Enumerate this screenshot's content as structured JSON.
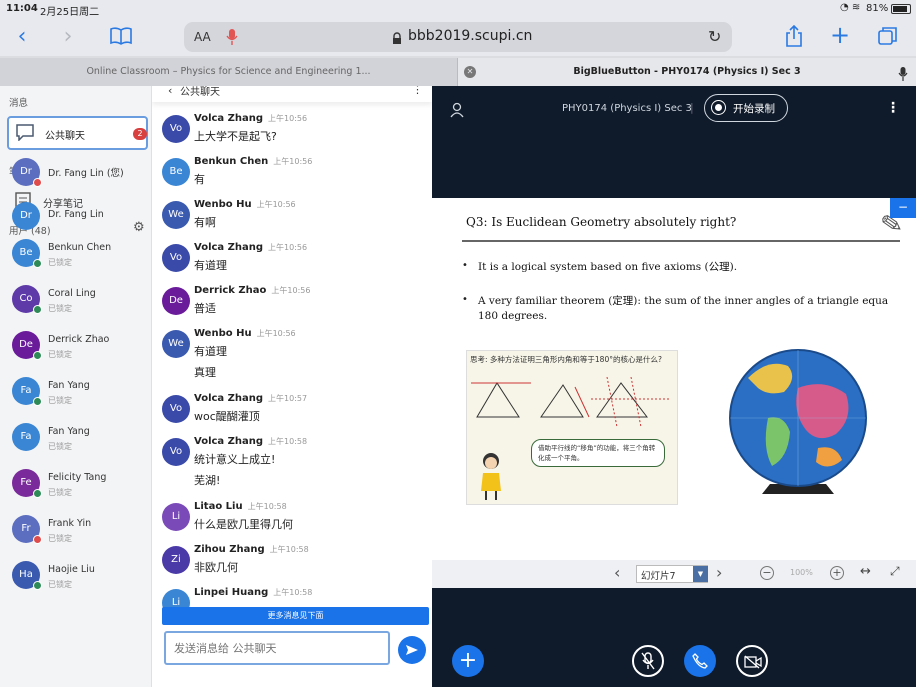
{
  "status_bar": {
    "time": "11:04",
    "date": "2月25日周二",
    "battery": "81%"
  },
  "browser": {
    "text_size_label": "AA",
    "url": "bbb2019.scupi.cn",
    "tabs": [
      {
        "title": "Online Classroom – Physics for Science and Engineering 1..."
      },
      {
        "title": "BigBlueButton - PHY0174 (Physics I) Sec 3"
      }
    ]
  },
  "sidebar": {
    "messages_heading": "消息",
    "public_chat": {
      "label": "公共聊天",
      "unread": "2"
    },
    "notes_heading": "笔记",
    "shared_notes_label": "分享笔记",
    "users_heading": "用户 (48)",
    "users": [
      {
        "initials": "Dr",
        "name": "Dr. Fang Lin (您)",
        "sub": "",
        "color": "#5b6ebf",
        "badge": "#e04b4b"
      },
      {
        "initials": "Dr",
        "name": "Dr. Fang Lin",
        "sub": "",
        "color": "#3a86d4",
        "badge": ""
      },
      {
        "initials": "Be",
        "name": "Benkun Chen",
        "sub": "已锁定",
        "color": "#3a86d4",
        "badge": "#2e8b57"
      },
      {
        "initials": "Co",
        "name": "Coral Ling",
        "sub": "已锁定",
        "color": "#5d3aa8",
        "badge": "#2e8b57"
      },
      {
        "initials": "De",
        "name": "Derrick Zhao",
        "sub": "已锁定",
        "color": "#6a1b9a",
        "badge": "#2e8b57"
      },
      {
        "initials": "Fa",
        "name": "Fan Yang",
        "sub": "已锁定",
        "color": "#3a86d4",
        "badge": "#2e8b57"
      },
      {
        "initials": "Fa",
        "name": "Fan Yang",
        "sub": "已锁定",
        "color": "#3a86d4",
        "badge": ""
      },
      {
        "initials": "Fe",
        "name": "Felicity Tang",
        "sub": "已锁定",
        "color": "#7a2a9a",
        "badge": "#2e8b57"
      },
      {
        "initials": "Fr",
        "name": "Frank Yin",
        "sub": "已锁定",
        "color": "#5b6ebf",
        "badge": "#e04b4b"
      },
      {
        "initials": "Ha",
        "name": "Haojie Liu",
        "sub": "已锁定",
        "color": "#3a5ab0",
        "badge": "#2e8b57"
      }
    ]
  },
  "chat": {
    "title": "公共聊天",
    "messages": [
      {
        "initials": "Vo",
        "color": "#3a4aa8",
        "name": "Volca Zhang",
        "time": "上午10:56",
        "lines": [
          "上大学不是起飞?"
        ]
      },
      {
        "initials": "Be",
        "color": "#3a86d4",
        "name": "Benkun Chen",
        "time": "上午10:56",
        "lines": [
          "有"
        ]
      },
      {
        "initials": "We",
        "color": "#3a5ab0",
        "name": "Wenbo Hu",
        "time": "上午10:56",
        "lines": [
          "有啊"
        ]
      },
      {
        "initials": "Vo",
        "color": "#3a4aa8",
        "name": "Volca Zhang",
        "time": "上午10:56",
        "lines": [
          "有道理"
        ]
      },
      {
        "initials": "De",
        "color": "#6a1b9a",
        "name": "Derrick Zhao",
        "time": "上午10:56",
        "lines": [
          "普适"
        ]
      },
      {
        "initials": "We",
        "color": "#3a5ab0",
        "name": "Wenbo Hu",
        "time": "上午10:56",
        "lines": [
          "有道理",
          "真理"
        ]
      },
      {
        "initials": "Vo",
        "color": "#3a4aa8",
        "name": "Volca Zhang",
        "time": "上午10:57",
        "lines": [
          "woc醍醐灌顶"
        ]
      },
      {
        "initials": "Vo",
        "color": "#3a4aa8",
        "name": "Volca Zhang",
        "time": "上午10:58",
        "lines": [
          "统计意义上成立!",
          "芜湖!"
        ]
      },
      {
        "initials": "Li",
        "color": "#7a4ab8",
        "name": "Litao Liu",
        "time": "上午10:58",
        "lines": [
          "什么是欧几里得几何"
        ]
      },
      {
        "initials": "Zi",
        "color": "#4a3aa8",
        "name": "Zihou Zhang",
        "time": "上午10:58",
        "lines": [
          "非欧几何"
        ]
      },
      {
        "initials": "Li",
        "color": "#3a86d4",
        "name": "Linpei Huang",
        "time": "上午10:58",
        "lines": [
          ""
        ]
      }
    ],
    "more_messages_label": "更多消息见下面",
    "input_placeholder": "发送消息给 公共聊天"
  },
  "bbb": {
    "room_title": "PHY0174 (Physics I) Sec 3",
    "record_label": "开始录制",
    "slide": {
      "question": "Q3:  Is Euclidean Geometry absolutely right?",
      "bullet1": "It is a logical system based on five axioms (公理).",
      "bullet2a": "A very familiar theorem (定理): the sum of the inner angles of a triangle equa",
      "bullet2b": "180 degrees.",
      "fig_title": "思考: 多种方法证明三角形内角和等于180°的核心是什么?",
      "fig_hint": "借助平行线的“移角”的功能，将三个角转化成一个平角。"
    },
    "slide_nav": {
      "label": "幻灯片7",
      "zoom": "100%"
    },
    "toolbar_color": "#e02020",
    "accent": "#1a73e8"
  }
}
